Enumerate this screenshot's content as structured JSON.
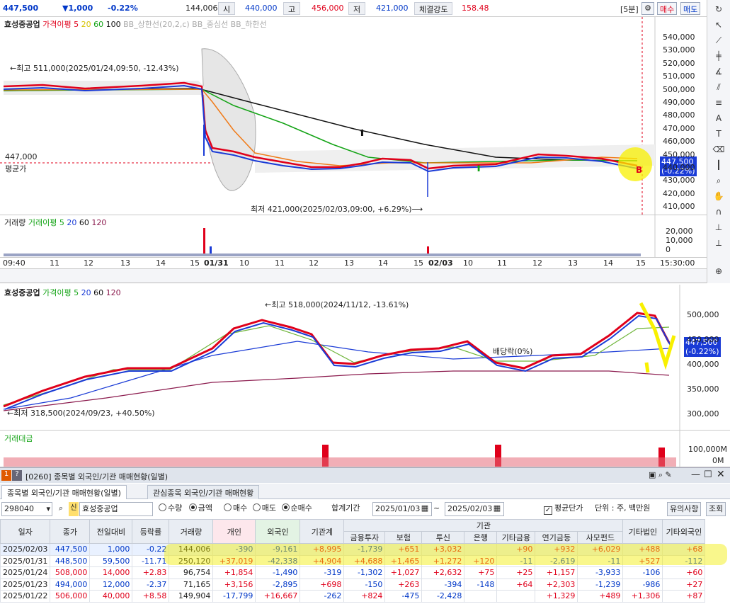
{
  "quote": {
    "price": "447,500",
    "change": "▼1,000",
    "change_rate": "-0.22%",
    "volume": "144,006",
    "open_label": "시",
    "open": "440,000",
    "high_label": "고",
    "high": "456,000",
    "low_label": "저",
    "low": "421,000",
    "strength_label": "체결강도",
    "strength": "158.48",
    "period": "[5분]",
    "buy_button": "매수",
    "sell_button": "매도"
  },
  "chart1": {
    "legend": {
      "stock": "효성중공업",
      "ma_label": "가격이평",
      "ma5": "5",
      "ma20": "20",
      "ma60": "60",
      "ma100": "100",
      "bb_upper": "BB_상한선(20,2,c)",
      "bb_mid": "BB_중심선",
      "bb_lower": "BB_하한선"
    },
    "high_note": "←최고 511,000(2025/01/24,09:50, -12.43%)",
    "low_note": "최저 421,000(2025/02/03,09:00, +6.29%)⟶",
    "avg_price": "447,000",
    "avg_label": "평균가",
    "cur_price": "447,500",
    "cur_rate": "(-0.22%)",
    "y_ticks": [
      "540,000",
      "530,000",
      "520,000",
      "510,000",
      "500,000",
      "490,000",
      "480,000",
      "470,000",
      "460,000",
      "450,000",
      "440,000",
      "430,000",
      "420,000",
      "410,000"
    ],
    "volume_legend": {
      "vol": "거래량",
      "ma_label": "거래이평",
      "ma5": "5",
      "ma20": "20",
      "ma60": "60",
      "ma120": "120"
    },
    "vol_ticks": [
      "20,000",
      "10,000",
      "0"
    ],
    "x_ticks": [
      "09:40",
      "11",
      "12",
      "13",
      "14",
      "15",
      "01/31",
      "10",
      "11",
      "12",
      "13",
      "14",
      "15",
      "02/03",
      "10",
      "11",
      "12",
      "13",
      "14",
      "15",
      "15:30:00"
    ],
    "chart_data": {
      "type": "candlestick",
      "interval": "5m",
      "ylim": [
        410000,
        540000
      ],
      "high": 511000,
      "low": 421000,
      "last": 447500
    }
  },
  "chart2": {
    "legend": {
      "stock": "효성중공업",
      "ma_label": "가격이평",
      "ma5": "5",
      "ma20": "20",
      "ma60": "60",
      "ma120": "120"
    },
    "high_note": "←최고 518,000(2024/11/12, -13.61%)",
    "low_note": "←최저 318,500(2024/09/23, +40.50%)",
    "dividend_note": "배당락(0%)",
    "cur_price": "447,500",
    "cur_rate": "(-0.22%)",
    "y_ticks": [
      "500,000",
      "450,000",
      "400,000",
      "350,000",
      "300,000"
    ],
    "amount_label": "거래대금",
    "amount_ticks": [
      "100,000M",
      "0M"
    ],
    "chart_data": {
      "type": "candlestick",
      "interval": "1d",
      "ylim": [
        290000,
        530000
      ],
      "high": 518000,
      "low": 318500,
      "last": 447500
    }
  },
  "window": {
    "title": "[0260] 종목별 외국인/기관 매매현황(일별)",
    "tab1": "종목별 외국인/기관 매매현황(일별)",
    "tab2": "관심종목 외국인/기관 매매현황"
  },
  "filter": {
    "code": "298040",
    "tag": "신",
    "name": "효성중공업",
    "qty": "수량",
    "amount": "금액",
    "buy": "매수",
    "sell": "매도",
    "net": "순매수",
    "period_label": "합계기간",
    "date_from": "2025/01/03",
    "tilde": "~",
    "date_to": "2025/02/03",
    "avg_check": "평균단가",
    "unit": "단위 : 주, 백만원",
    "notice": "유의사항",
    "query": "조회"
  },
  "table": {
    "headers": [
      "일자",
      "종가",
      "전일대비",
      "등락률",
      "거래량",
      "개인",
      "외국인",
      "기관계",
      "기관",
      "기타법인",
      "기타외국인"
    ],
    "inst_headers": [
      "금융투자",
      "보험",
      "투신",
      "은행",
      "기타금융",
      "연기금등",
      "사모펀드"
    ],
    "rows": [
      [
        "2025/02/03",
        "447,500",
        "1,000",
        "-0.22",
        "144,006",
        "-390",
        "-9,161",
        "+8,995",
        "-1,739",
        "+651",
        "+3,032",
        "",
        "+90",
        "+932",
        "+6,029",
        "+488",
        "+68"
      ],
      [
        "2025/01/31",
        "448,500",
        "59,500",
        "-11.71",
        "250,120",
        "+37,019",
        "-42,338",
        "+4,904",
        "+4,688",
        "+1,465",
        "+1,272",
        "+120",
        "-11",
        "-2,619",
        "-11",
        "+527",
        "-112"
      ],
      [
        "2025/01/24",
        "508,000",
        "14,000",
        "+2.83",
        "96,754",
        "+1,854",
        "-1,490",
        "-319",
        "-1,302",
        "+1,027",
        "+2,632",
        "+75",
        "+25",
        "+1,157",
        "-3,933",
        "-106",
        "+60"
      ],
      [
        "2025/01/23",
        "494,000",
        "12,000",
        "-2.37",
        "71,165",
        "+3,156",
        "-2,895",
        "+698",
        "-150",
        "+263",
        "-394",
        "-148",
        "+64",
        "+2,303",
        "-1,239",
        "-986",
        "+27"
      ],
      [
        "2025/01/22",
        "506,000",
        "40,000",
        "+8.58",
        "149,904",
        "-17,799",
        "+16,667",
        "-262",
        "+824",
        "-475",
        "-2,428",
        "",
        "",
        "+1,329",
        "+489",
        "+1,306",
        "+87"
      ]
    ],
    "change_dir": [
      "down",
      "down",
      "up",
      "down",
      "up"
    ]
  }
}
